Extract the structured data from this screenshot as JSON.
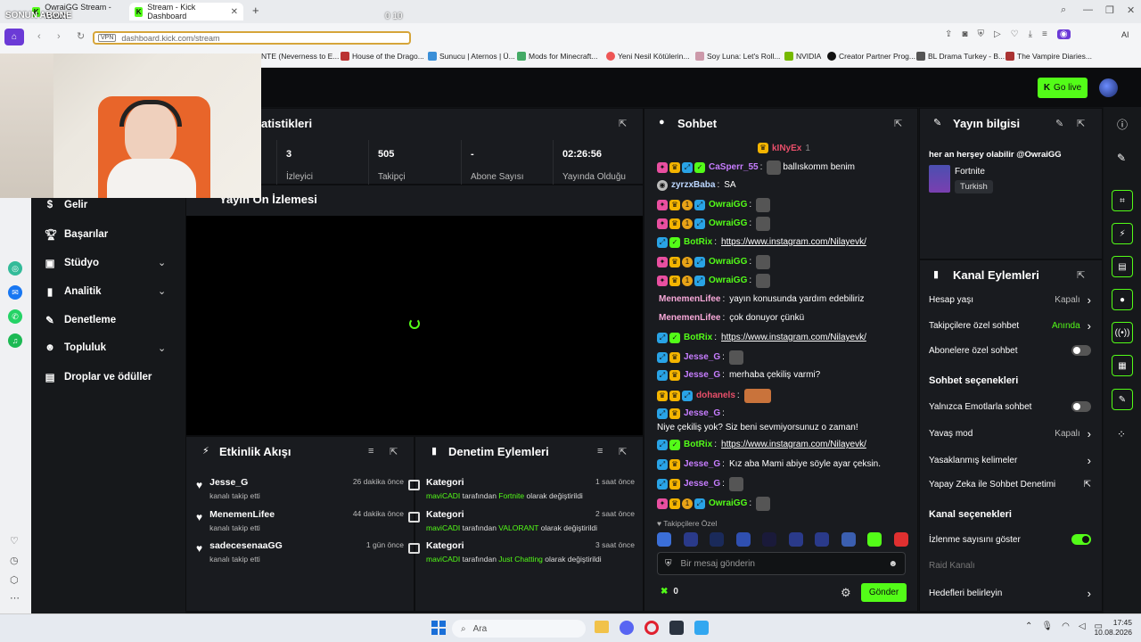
{
  "browser": {
    "tabs": [
      {
        "label": "OwraiGG Stream - Watch"
      },
      {
        "label": "Stream - Kick Dashboard"
      }
    ],
    "overlay_text": "SONUN ABONE",
    "overlay_counter": "0  10",
    "url": "dashboard.kick.com/stream",
    "vpn_label": "VPN",
    "bookmarks": [
      "NTE (Neverness to E...",
      "House of the Drago...",
      "Sunucu | Aternos | Ü...",
      "Mods for Minecraft...",
      "Yeni Nesil Kötülerin...",
      "Soy Luna: Let's Roll...",
      "NVIDIA",
      "Creator Partner Prog...",
      "BL Drama Turkey - B...",
      "The Vampire Diaries..."
    ],
    "ai_label": "AI"
  },
  "header": {
    "go_live": "Go live"
  },
  "sidebar": {
    "items": [
      {
        "label": "Gelir",
        "icon": "dollar-icon"
      },
      {
        "label": "Başarılar",
        "icon": "trophy-icon"
      },
      {
        "label": "Stüdyo",
        "icon": "studio-icon"
      },
      {
        "label": "Analitik",
        "icon": "chart-icon"
      },
      {
        "label": "Denetleme",
        "icon": "wrench-icon"
      },
      {
        "label": "Topluluk",
        "icon": "users-icon"
      },
      {
        "label": "Droplar ve ödüller",
        "icon": "gift-icon"
      }
    ]
  },
  "stats": {
    "title": "atistikleri",
    "cells": [
      {
        "value": "3",
        "label": "İzleyici"
      },
      {
        "value": "505",
        "label": "Takipçi"
      },
      {
        "value": "-",
        "label": "Abone Sayısı"
      },
      {
        "value": "02:26:56",
        "label": "Yayında Olduğu"
      }
    ]
  },
  "preview": {
    "title": "Yayın Ön İzlemesi"
  },
  "activity": {
    "title": "Etkinlik Akışı",
    "events": [
      {
        "name": "Jesse_G",
        "sub": "kanalı takip etti",
        "time": "26 dakika önce"
      },
      {
        "name": "MenemenLifee",
        "sub": "kanalı takip etti",
        "time": "44 dakika önce"
      },
      {
        "name": "sadecesenaaGG",
        "sub": "kanalı takip etti",
        "time": "1 gün önce"
      }
    ]
  },
  "moderation": {
    "title": "Denetim Eylemleri",
    "actions": [
      {
        "name": "Kategori",
        "user": "maviCADI",
        "mid": "tarafından",
        "value": "Fortnite",
        "tail": "olarak değiştirildi",
        "time": "1 saat önce"
      },
      {
        "name": "Kategori",
        "user": "maviCADI",
        "mid": "tarafından",
        "value": "VALORANT",
        "tail": "olarak değiştirildi",
        "time": "2 saat önce"
      },
      {
        "name": "Kategori",
        "user": "maviCADI",
        "mid": "tarafından",
        "value": "Just Chatting",
        "tail": "olarak değiştirildi",
        "time": "3 saat önce"
      }
    ]
  },
  "chat": {
    "title": "Sohbet",
    "pinned_user": "kINyEx",
    "pinned_count": "1",
    "messages": [
      {
        "user": "CaSperr_55",
        "color": "#c77dff",
        "text": "ballıskomm benim",
        "badges": [
          "p",
          "y",
          "c",
          "g"
        ],
        "emote": true
      },
      {
        "user": "zyrzxBaba",
        "color": "#bcd7ff",
        "text": "SA",
        "badges": [
          "gray"
        ],
        "emote": false
      },
      {
        "user": "OwraiGG",
        "color": "#53fc18",
        "text": "",
        "badges": [
          "p",
          "y",
          "o",
          "c"
        ],
        "emote": true
      },
      {
        "user": "OwraiGG",
        "color": "#53fc18",
        "text": "",
        "badges": [
          "p",
          "y",
          "o",
          "c"
        ],
        "emote": true
      },
      {
        "user": "BotRix",
        "color": "#53fc18",
        "text": "https://www.instagram.com/Nilayevk/",
        "badges": [
          "c",
          "g"
        ],
        "emote": false,
        "link": true
      },
      {
        "user": "OwraiGG",
        "color": "#53fc18",
        "text": "",
        "badges": [
          "p",
          "y",
          "o",
          "c"
        ],
        "emote": true
      },
      {
        "user": "OwraiGG",
        "color": "#53fc18",
        "text": "",
        "badges": [
          "p",
          "y",
          "o",
          "c"
        ],
        "emote": true
      },
      {
        "user": "MenemenLifee",
        "color": "#f7a8d8",
        "text": "yayın konusunda yardım edebiliriz",
        "badges": [],
        "emote": false
      },
      {
        "user": "MenemenLifee",
        "color": "#f7a8d8",
        "text": "çok donuyor çünkü",
        "badges": [],
        "emote": false
      },
      {
        "user": "BotRix",
        "color": "#53fc18",
        "text": "https://www.instagram.com/Nilayevk/",
        "badges": [
          "c",
          "g"
        ],
        "emote": false,
        "link": true
      },
      {
        "user": "Jesse_G",
        "color": "#c77dff",
        "text": "",
        "badges": [
          "c",
          "y"
        ],
        "emote": true
      },
      {
        "user": "Jesse_G",
        "color": "#c77dff",
        "text": "merhaba çekiliş varmi?",
        "badges": [
          "c",
          "y"
        ],
        "emote": false
      },
      {
        "user": "dohanels",
        "color": "#e94f6a",
        "text": "",
        "badges": [
          "y",
          "y",
          "c"
        ],
        "emote": true
      },
      {
        "user": "Jesse_G",
        "color": "#c77dff",
        "text": "Niye çekiliş yok? Siz beni sevmiyorsunuz o zaman!",
        "badges": [
          "c",
          "y"
        ],
        "emote": false
      },
      {
        "user": "BotRix",
        "color": "#53fc18",
        "text": "https://www.instagram.com/Nilayevk/",
        "badges": [
          "c",
          "g"
        ],
        "emote": false,
        "link": true
      },
      {
        "user": "Jesse_G",
        "color": "#c77dff",
        "text": "Kız aba Mami abiye söyle ayar çeksin.",
        "badges": [
          "c",
          "y"
        ],
        "emote": false
      },
      {
        "user": "Jesse_G",
        "color": "#c77dff",
        "text": "",
        "badges": [
          "c",
          "y"
        ],
        "emote": true
      },
      {
        "user": "OwraiGG",
        "color": "#53fc18",
        "text": "",
        "badges": [
          "p",
          "y",
          "o",
          "c"
        ],
        "emote": true
      }
    ],
    "emote_section": "Takipçilere Özel",
    "input_placeholder": "Bir mesaj gönderin",
    "points": "0",
    "send": "Gönder"
  },
  "stream_info": {
    "title": "Yayın bilgisi",
    "stream_title": "her an herşey olabilir @OwraiGG",
    "category": "Fortnite",
    "language": "Turkish"
  },
  "channel_actions": {
    "title": "Kanal Eylemleri",
    "rows": [
      {
        "label": "Hesap yaşı",
        "value": "Kapalı",
        "kind": "chevron"
      },
      {
        "label": "Takipçilere özel sohbet",
        "value": "Anında",
        "kind": "chevron-green"
      },
      {
        "label": "Abonelere özel sohbet",
        "kind": "toggle-off"
      }
    ],
    "chat_options_title": "Sohbet seçenekleri",
    "chat_options": [
      {
        "label": "Yalnızca Emotlarla sohbet",
        "kind": "toggle-off"
      },
      {
        "label": "Yavaş mod",
        "value": "Kapalı",
        "kind": "chevron"
      },
      {
        "label": "Yasaklanmış kelimeler",
        "kind": "chevron"
      },
      {
        "label": "Yapay Zeka ile Sohbet Denetimi",
        "kind": "external"
      }
    ],
    "channel_options_title": "Kanal seçenekleri",
    "channel_options": [
      {
        "label": "İzlenme sayısını göster",
        "kind": "toggle-on"
      },
      {
        "label": "Raid Kanalı",
        "kind": "disabled"
      },
      {
        "label": "Hedefleri belirleyin",
        "kind": "chevron"
      }
    ]
  },
  "taskbar": {
    "search": "Ara",
    "time": "17:45",
    "date": "10.08.2026"
  },
  "colors": {
    "accent": "#53fc18",
    "bg": "#111315",
    "panel": "#191b1f"
  }
}
